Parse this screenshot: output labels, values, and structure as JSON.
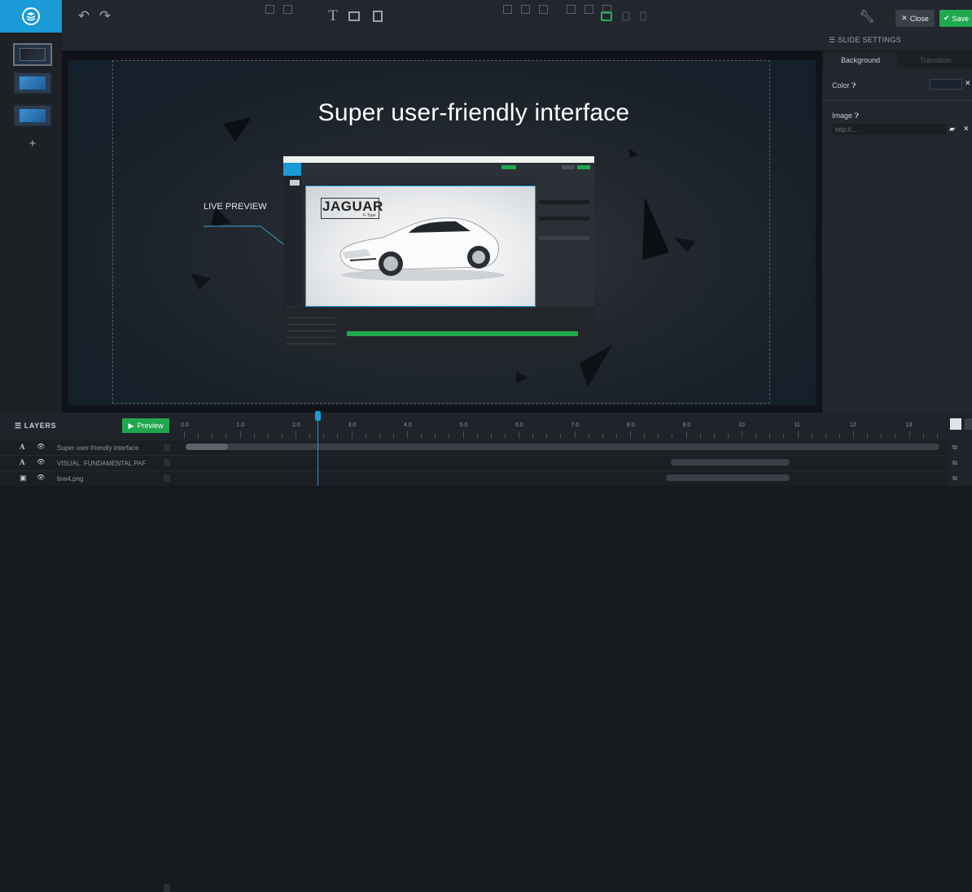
{
  "topbar": {
    "close_label": "Close",
    "save_label": "Save",
    "close_icon": "close-icon",
    "save_icon": "check-icon"
  },
  "right_panel": {
    "title": "SLIDE SETTINGS",
    "tabs": [
      "Background",
      "Transition"
    ],
    "active_tab": "Background",
    "color_label": "Color",
    "image_label": "Image",
    "image_placeholder": "http://..."
  },
  "canvas": {
    "headline": "Super user-friendly interface",
    "live_preview": "LIVE PREVIEW",
    "jaguar": "JAGUAR",
    "ftype": "F-Type"
  },
  "timeline": {
    "title": "LAYERS",
    "preview_label": "Preview",
    "ticks": [
      "0.0",
      "1.0",
      "2.0",
      "3.0",
      "4.0",
      "5.0",
      "6.0",
      "7.0",
      "8.0",
      "9.0",
      "10",
      "11",
      "12",
      "13"
    ],
    "layers": [
      {
        "name": "Super user-friendly interface",
        "type_icon": "text-icon"
      },
      {
        "name": "VISUAL. FUNDAMENTAL PAF",
        "type_icon": "text-icon"
      },
      {
        "name": "line4.png",
        "type_icon": "image-icon"
      }
    ]
  },
  "colors": {
    "accent": "#1a9ad6",
    "success": "#21a74e"
  }
}
